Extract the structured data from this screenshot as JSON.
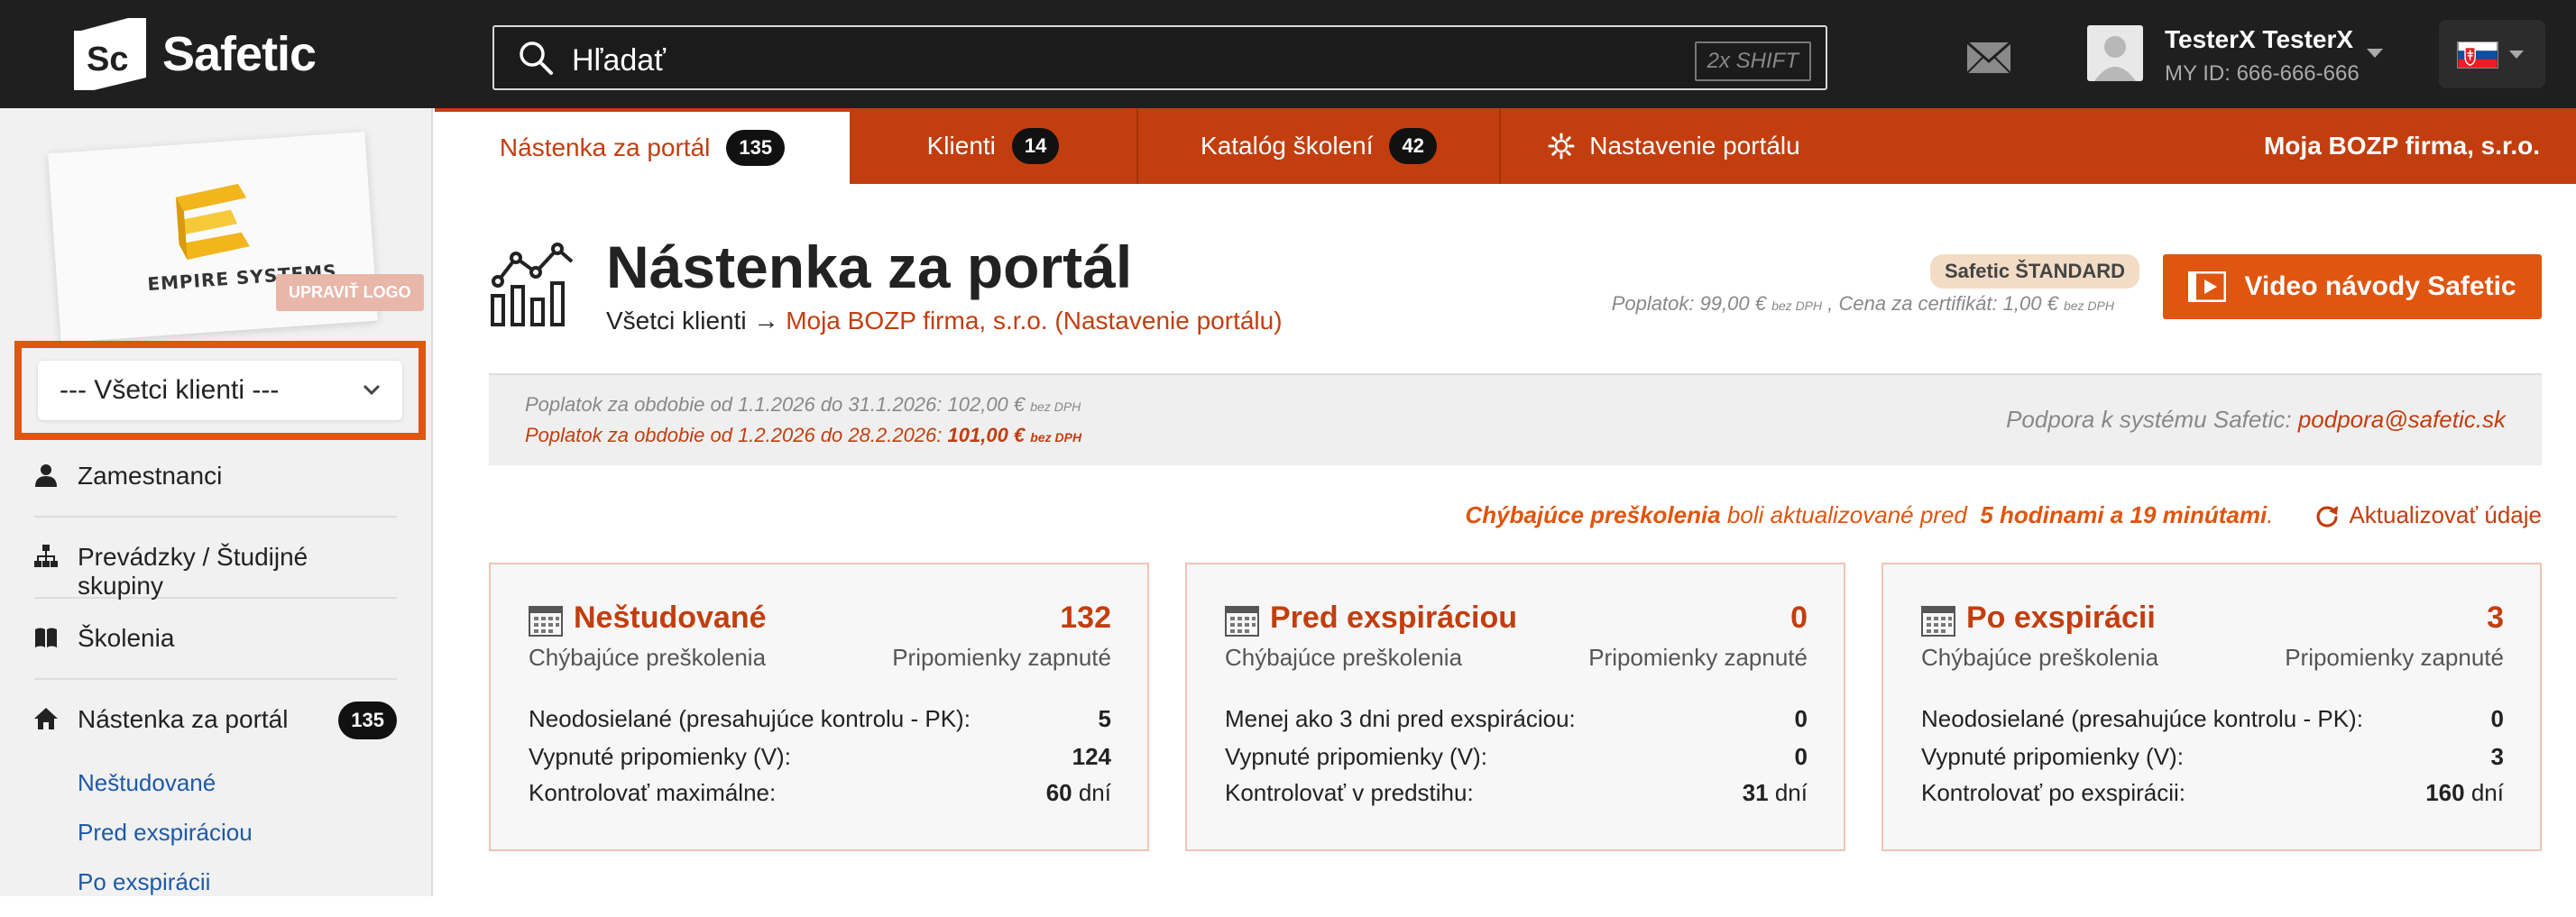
{
  "app": {
    "brand": "Safetic",
    "logo_mark": "Sc"
  },
  "search": {
    "placeholder": "Hľadať",
    "shortcut": "2x SHIFT"
  },
  "user": {
    "name": "TesterX TesterX",
    "id_text": "MY ID: 666-666-666"
  },
  "sidebar": {
    "logo_card_text": "EMPIRE SYSTEMS",
    "edit_logo_label": "UPRAVIŤ LOGO",
    "client_select_value": "--- Všetci klienti ---",
    "items": [
      {
        "label": "Zamestnanci",
        "icon": "user-icon"
      },
      {
        "label": "Prevádzky / Študijné skupiny",
        "icon": "org-chart-icon"
      },
      {
        "label": "Školenia",
        "icon": "book-icon"
      },
      {
        "label": "Nástenka za portál",
        "icon": "home-icon",
        "badge": "135"
      }
    ],
    "subitems": [
      "Neštudované",
      "Pred exspiráciou",
      "Po exspirácii"
    ]
  },
  "tabs": [
    {
      "label": "Nástenka za portál",
      "badge": "135",
      "active": true
    },
    {
      "label": "Klienti",
      "badge": "14"
    },
    {
      "label": "Katalóg školení",
      "badge": "42"
    },
    {
      "label": "Nastavenie portálu",
      "icon": "gear-icon"
    }
  ],
  "tabs_company": "Moja BOZP firma, s.r.o.",
  "page": {
    "title": "Nástenka za portál",
    "breadcrumb_root": "Všetci klienti",
    "breadcrumb_arrow": "→",
    "breadcrumb_link": "Moja BOZP firma, s.r.o. (Nastavenie portálu)",
    "plan_badge": "Safetic ŠTANDARD",
    "plan_fee_a": "Poplatok: 99,00 €",
    "plan_fee_b": ", Cena za certifikát: 1,00 €",
    "tax_note": "bez DPH",
    "video_button": "Video návody Safetic"
  },
  "info": {
    "fee_period_1": "Poplatok za obdobie od 1.1.2026 do 31.1.2026: 102,00 €",
    "fee_period_2_text": "Poplatok za obdobie od 1.2.2026 do 28.2.2026:",
    "fee_period_2_amount": "101,00 €",
    "tax_note": "bez DPH",
    "support_label": "Podpora k systému Safetic:",
    "support_email": "podpora@safetic.sk"
  },
  "update": {
    "highlight": "Chýbajúce preškolenia",
    "text": "boli aktualizované pred",
    "time": "5 hodinami a 19 minútami",
    "dot": ".",
    "button": "Aktualizovať údaje"
  },
  "cards": [
    {
      "title": "Neštudované",
      "count": "132",
      "sub": "Chýbajúce preškolenia",
      "reminders": "Pripomienky zapnuté",
      "rows": [
        {
          "label": "Neodosielané (presahujúce kontrolu - PK):",
          "value": "5",
          "unit": ""
        },
        {
          "label": "Vypnuté pripomienky (V):",
          "value": "124",
          "unit": ""
        },
        {
          "label": "Kontrolovať maximálne:",
          "value": "60",
          "unit": "dní"
        }
      ]
    },
    {
      "title": "Pred exspiráciou",
      "count": "0",
      "sub": "Chýbajúce preškolenia",
      "reminders": "Pripomienky zapnuté",
      "rows": [
        {
          "label": "Menej ako 3 dni pred exspiráciou:",
          "value": "0",
          "unit": ""
        },
        {
          "label": "Vypnuté pripomienky (V):",
          "value": "0",
          "unit": ""
        },
        {
          "label": "Kontrolovať v predstihu:",
          "value": "31",
          "unit": "dní"
        }
      ]
    },
    {
      "title": "Po exspirácii",
      "count": "3",
      "sub": "Chýbajúce preškolenia",
      "reminders": "Pripomienky zapnuté",
      "rows": [
        {
          "label": "Neodosielané (presahujúce kontrolu - PK):",
          "value": "0",
          "unit": ""
        },
        {
          "label": "Vypnuté pripomienky (V):",
          "value": "3",
          "unit": ""
        },
        {
          "label": "Kontrolovať po exspirácii:",
          "value": "160",
          "unit": "dní"
        }
      ]
    }
  ],
  "colors": {
    "brand": "#c23e0f",
    "accent": "#e0550f",
    "topbar": "#1f1f1f"
  }
}
